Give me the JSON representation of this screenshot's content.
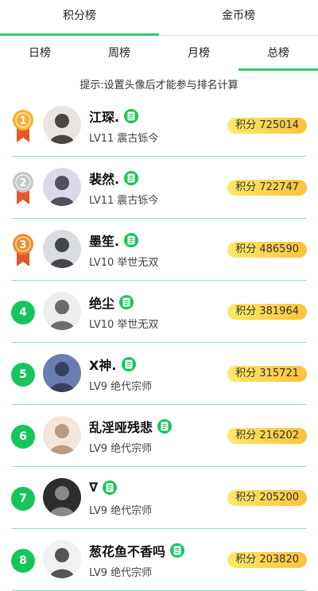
{
  "top_tabs": [
    {
      "label": "积分榜",
      "active": true
    },
    {
      "label": "金币榜",
      "active": false
    }
  ],
  "sub_tabs": [
    {
      "label": "日榜",
      "active": false
    },
    {
      "label": "周榜",
      "active": false
    },
    {
      "label": "月榜",
      "active": false
    },
    {
      "label": "总榜",
      "active": true
    }
  ],
  "hint": "提示:设置头像后才能参与排名计算",
  "rows": [
    {
      "rank": "1",
      "name": "江琛.",
      "level": "LV11 震古铄今",
      "score": "积分 725014",
      "medal": "gold"
    },
    {
      "rank": "2",
      "name": "裴然.",
      "level": "LV11 震古铄今",
      "score": "积分 722747",
      "medal": "silver"
    },
    {
      "rank": "3",
      "name": "墨笙.",
      "level": "LV10 举世无双",
      "score": "积分 486590",
      "medal": "bronze"
    },
    {
      "rank": "4",
      "name": "绝尘",
      "level": "LV10 举世无双",
      "score": "积分 381964",
      "medal": "none"
    },
    {
      "rank": "5",
      "name": "X神.",
      "level": "LV9 绝代宗师",
      "score": "积分 315721",
      "medal": "none"
    },
    {
      "rank": "6",
      "name": "乱淫哑残悲",
      "level": "LV9 绝代宗师",
      "score": "积分 216202",
      "medal": "none"
    },
    {
      "rank": "7",
      "name": "∇",
      "level": "LV9 绝代宗师",
      "score": "积分 205200",
      "medal": "none"
    },
    {
      "rank": "8",
      "name": "葱花鱼不香吗",
      "level": "LV9 绝代宗师",
      "score": "积分 203820",
      "medal": "none"
    }
  ],
  "colors": {
    "accent": "#16c65b",
    "gold": "#f4b32c",
    "silver": "#c7c7c7",
    "bronze": "#f08c2c",
    "ribbon": "#e3572b",
    "score_bg": "#f9c23c"
  },
  "icons": {
    "badge": "verified-doc-icon",
    "medal": "medal-icon"
  }
}
